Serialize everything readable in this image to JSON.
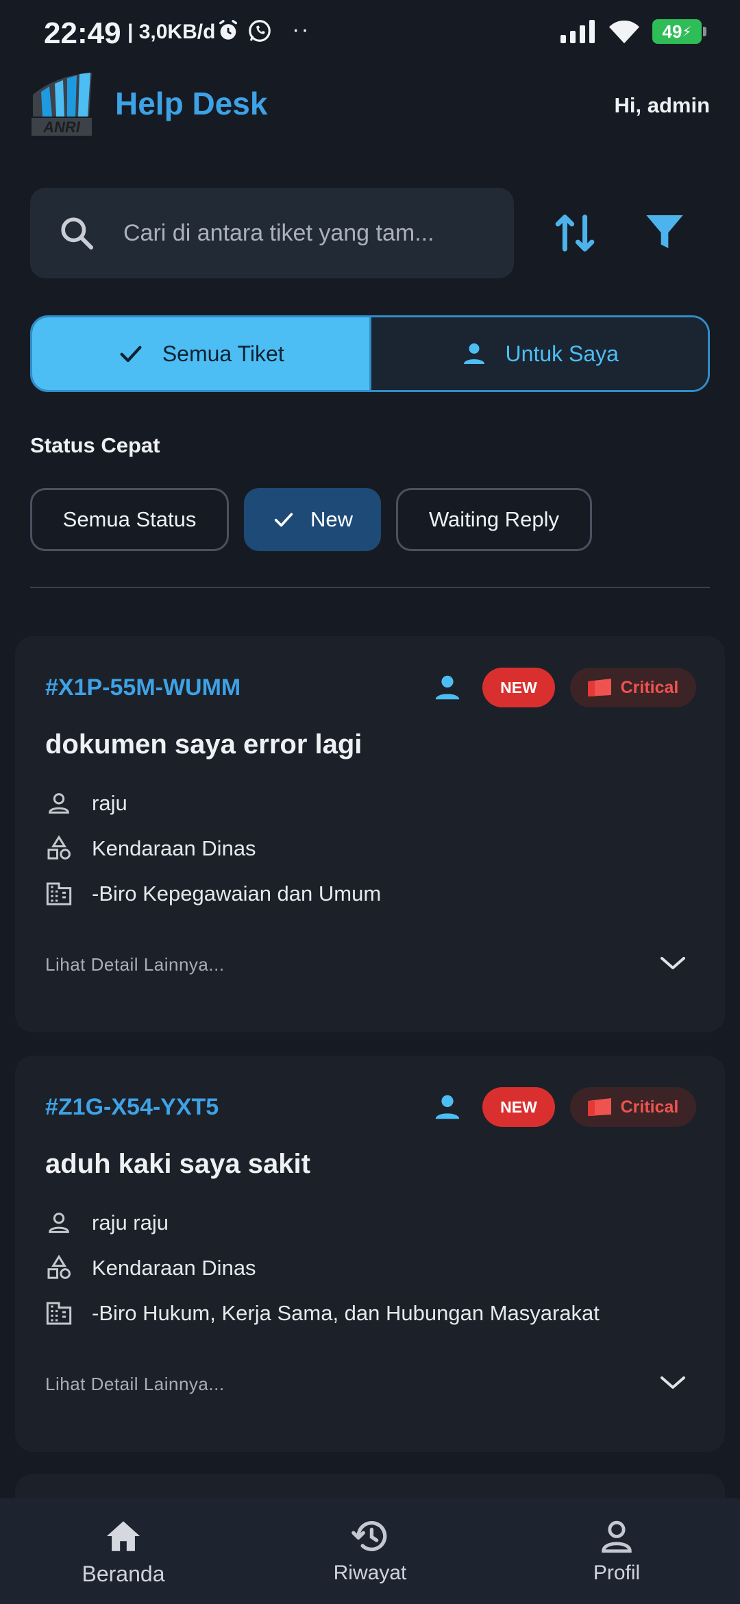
{
  "status_bar": {
    "time": "22:49",
    "network": "| 3,0KB/d",
    "dots": "··",
    "battery": "49"
  },
  "header": {
    "logo_text": "ANRI",
    "title": "Help Desk",
    "greeting": "Hi, admin"
  },
  "search": {
    "placeholder": "Cari di antara tiket yang tam..."
  },
  "segment": {
    "all_label": "Semua Tiket",
    "mine_label": "Untuk Saya"
  },
  "quick_status": {
    "title": "Status Cepat",
    "chips": [
      "Semua Status",
      "New",
      "Waiting Reply"
    ],
    "selected": "New"
  },
  "tickets": [
    {
      "id": "#X1P-55M-WUMM",
      "status": "NEW",
      "priority": "Critical",
      "title": "dokumen saya error lagi",
      "user": "raju",
      "category": "Kendaraan Dinas",
      "department": "-Biro Kepegawaian dan Umum",
      "more": "Lihat Detail Lainnya..."
    },
    {
      "id": "#Z1G-X54-YXT5",
      "status": "NEW",
      "priority": "Critical",
      "title": "aduh kaki saya sakit",
      "user": "raju raju",
      "category": "Kendaraan Dinas",
      "department": "-Biro Hukum, Kerja Sama, dan Hubungan Masyarakat",
      "more": "Lihat Detail Lainnya..."
    }
  ],
  "bottom_nav": {
    "items": [
      "Beranda",
      "Riwayat",
      "Profil"
    ],
    "active": "Beranda"
  },
  "colors": {
    "background": "#161b23",
    "accent": "#3ea2e6",
    "segment_active": "#4dbef4",
    "chip_active": "#1e4a78",
    "badge_new": "#d9302f",
    "critical_text": "#ef5350"
  }
}
